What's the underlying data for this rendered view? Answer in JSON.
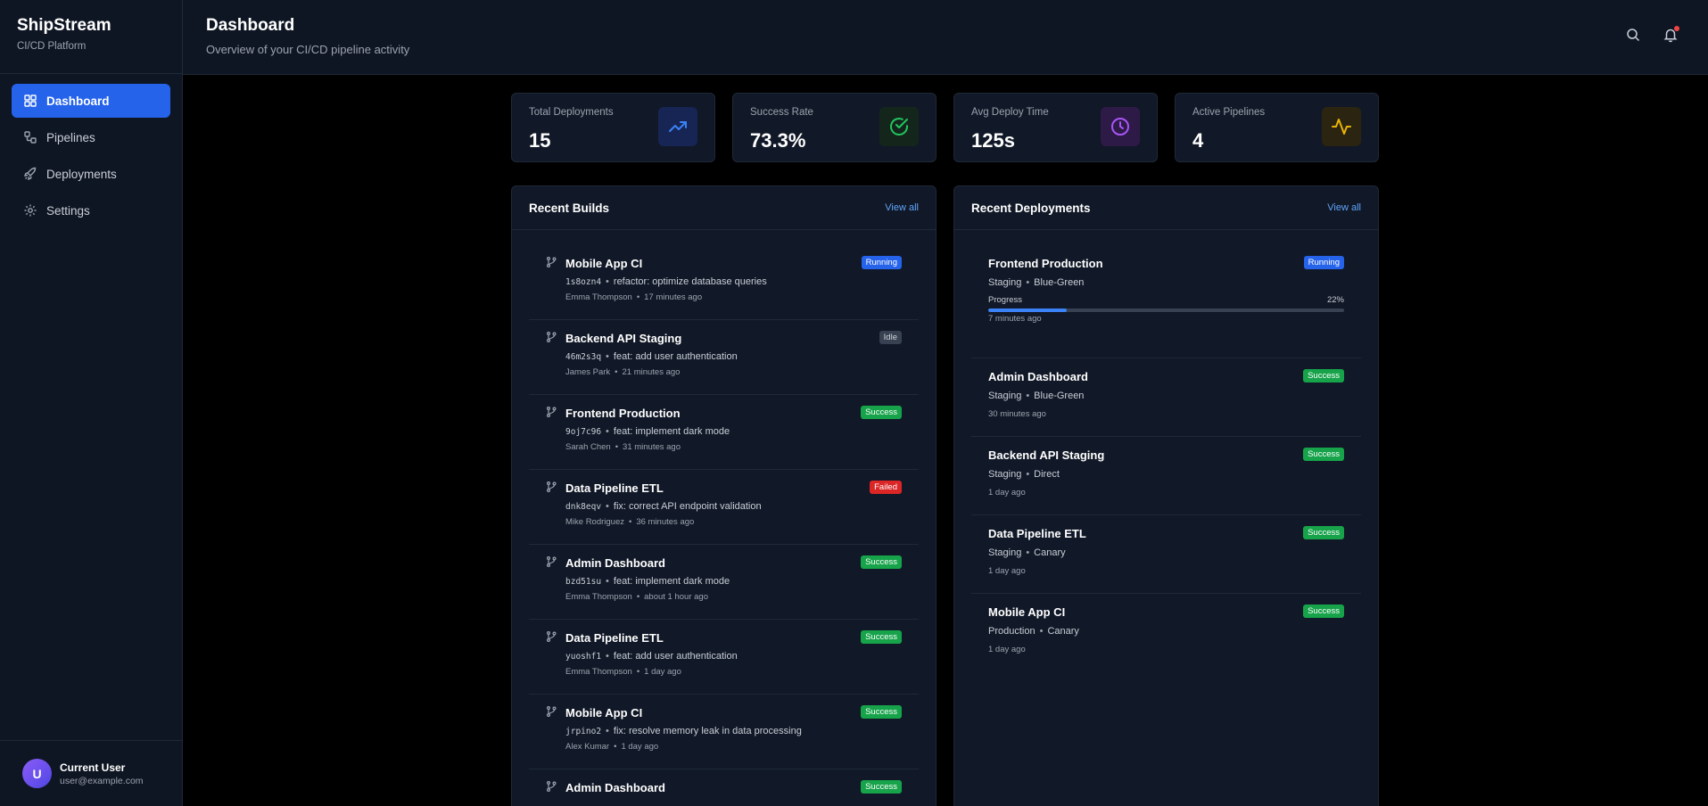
{
  "brand": {
    "name": "ShipStream",
    "subtitle": "CI/CD Platform"
  },
  "nav": [
    {
      "label": "Dashboard",
      "icon": "dashboard-icon",
      "active": true
    },
    {
      "label": "Pipelines",
      "icon": "pipelines-icon",
      "active": false
    },
    {
      "label": "Deployments",
      "icon": "rocket-icon",
      "active": false
    },
    {
      "label": "Settings",
      "icon": "gear-icon",
      "active": false
    }
  ],
  "user": {
    "initial": "U",
    "name": "Current User",
    "email": "user@example.com"
  },
  "header": {
    "title": "Dashboard",
    "subtitle": "Overview of your CI/CD pipeline activity"
  },
  "stats": [
    {
      "label": "Total Deployments",
      "value": "15",
      "icon": "trending-up-icon",
      "color": "#3b82f6"
    },
    {
      "label": "Success Rate",
      "value": "73.3%",
      "icon": "check-circle-icon",
      "color": "#22c55e"
    },
    {
      "label": "Avg Deploy Time",
      "value": "125s",
      "icon": "clock-icon",
      "color": "#a855f7"
    },
    {
      "label": "Active Pipelines",
      "value": "4",
      "icon": "activity-icon",
      "color": "#eab308"
    }
  ],
  "builds_panel": {
    "title": "Recent Builds",
    "view_all": "View all",
    "items": [
      {
        "name": "Mobile App CI",
        "sha": "1s8ozn4",
        "message": "refactor: optimize database queries",
        "author": "Emma Thompson",
        "time": "17 minutes ago",
        "status": "Running"
      },
      {
        "name": "Backend API Staging",
        "sha": "46m2s3q",
        "message": "feat: add user authentication",
        "author": "James Park",
        "time": "21 minutes ago",
        "status": "Idle"
      },
      {
        "name": "Frontend Production",
        "sha": "9oj7c96",
        "message": "feat: implement dark mode",
        "author": "Sarah Chen",
        "time": "31 minutes ago",
        "status": "Success"
      },
      {
        "name": "Data Pipeline ETL",
        "sha": "dnk8eqv",
        "message": "fix: correct API endpoint validation",
        "author": "Mike Rodriguez",
        "time": "36 minutes ago",
        "status": "Failed"
      },
      {
        "name": "Admin Dashboard",
        "sha": "bzd51su",
        "message": "feat: implement dark mode",
        "author": "Emma Thompson",
        "time": "about 1 hour ago",
        "status": "Success"
      },
      {
        "name": "Data Pipeline ETL",
        "sha": "yuoshf1",
        "message": "feat: add user authentication",
        "author": "Emma Thompson",
        "time": "1 day ago",
        "status": "Success"
      },
      {
        "name": "Mobile App CI",
        "sha": "jrpino2",
        "message": "fix: resolve memory leak in data processing",
        "author": "Alex Kumar",
        "time": "1 day ago",
        "status": "Success"
      },
      {
        "name": "Admin Dashboard",
        "sha": "",
        "message": "",
        "author": "",
        "time": "",
        "status": "Success"
      }
    ]
  },
  "deployments_panel": {
    "title": "Recent Deployments",
    "view_all": "View all",
    "progress_label": "Progress",
    "items": [
      {
        "name": "Frontend Production",
        "environment": "Staging",
        "strategy": "Blue-Green",
        "time": "7 minutes ago",
        "status": "Running",
        "progress": "22%"
      },
      {
        "name": "Admin Dashboard",
        "environment": "Staging",
        "strategy": "Blue-Green",
        "time": "30 minutes ago",
        "status": "Success"
      },
      {
        "name": "Backend API Staging",
        "environment": "Staging",
        "strategy": "Direct",
        "time": "1 day ago",
        "status": "Success"
      },
      {
        "name": "Data Pipeline ETL",
        "environment": "Staging",
        "strategy": "Canary",
        "time": "1 day ago",
        "status": "Success"
      },
      {
        "name": "Mobile App CI",
        "environment": "Production",
        "strategy": "Canary",
        "time": "1 day ago",
        "status": "Success"
      }
    ]
  }
}
